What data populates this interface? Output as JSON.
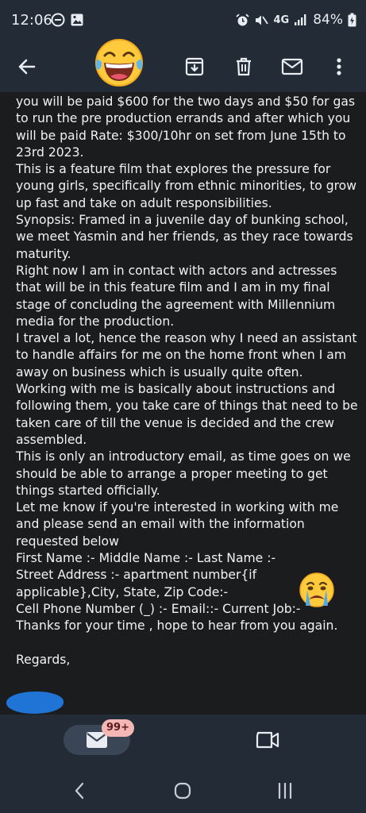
{
  "status_bar": {
    "time": "12:06",
    "network": "4G",
    "battery": "84%"
  },
  "toolbar": {
    "icons": [
      "back-arrow-icon",
      "archive-icon",
      "delete-icon",
      "mail-unread-icon",
      "more-vert-icon"
    ]
  },
  "message": {
    "paragraphs": [
      "you will be paid $600 for the two days and $50 for gas to run the pre production errands and after which you will be paid Rate: $300/10hr on set from June 15th to 23rd 2023.",
      "This is a feature film that explores the pressure for young girls, specifically from ethnic minorities, to grow up fast and take on adult responsibilities.",
      "Synopsis: Framed in a juvenile day of bunking school, we meet Yasmin and her friends, as they race towards maturity.",
      "Right now I am in contact with actors and actresses that will be in this feature film and I am in my final stage of concluding the agreement with Millennium media for the production.",
      "I travel a lot, hence the reason why I need an assistant to handle affairs for me on the home front when I am away on business which is usually quite often.",
      "Working with me is basically about instructions and following them, you take care of things that need to be taken care of till the venue is decided and the crew assembled.",
      "This is only an introductory email, as time goes on we should be able to arrange a proper meeting to get things started officially.",
      "Let me know if you're interested in working with me and please send an email with the information requested below",
      "First Name :- Middle Name :- Last Name :-",
      "Street Address :- apartment number{if applicable},City, State, Zip Code:-",
      "Cell Phone Number (_) :- Email::- Current Job:-",
      "Thanks for your time , hope to hear from you again."
    ],
    "regards": "Regards,"
  },
  "bottom_nav": {
    "mail_badge": "99+"
  },
  "colors": {
    "bar": "#222b36",
    "body": "#1b1c1e",
    "text": "#f2f2f2",
    "badge": "#f3b7b4",
    "redaction": "#1f74d6"
  }
}
